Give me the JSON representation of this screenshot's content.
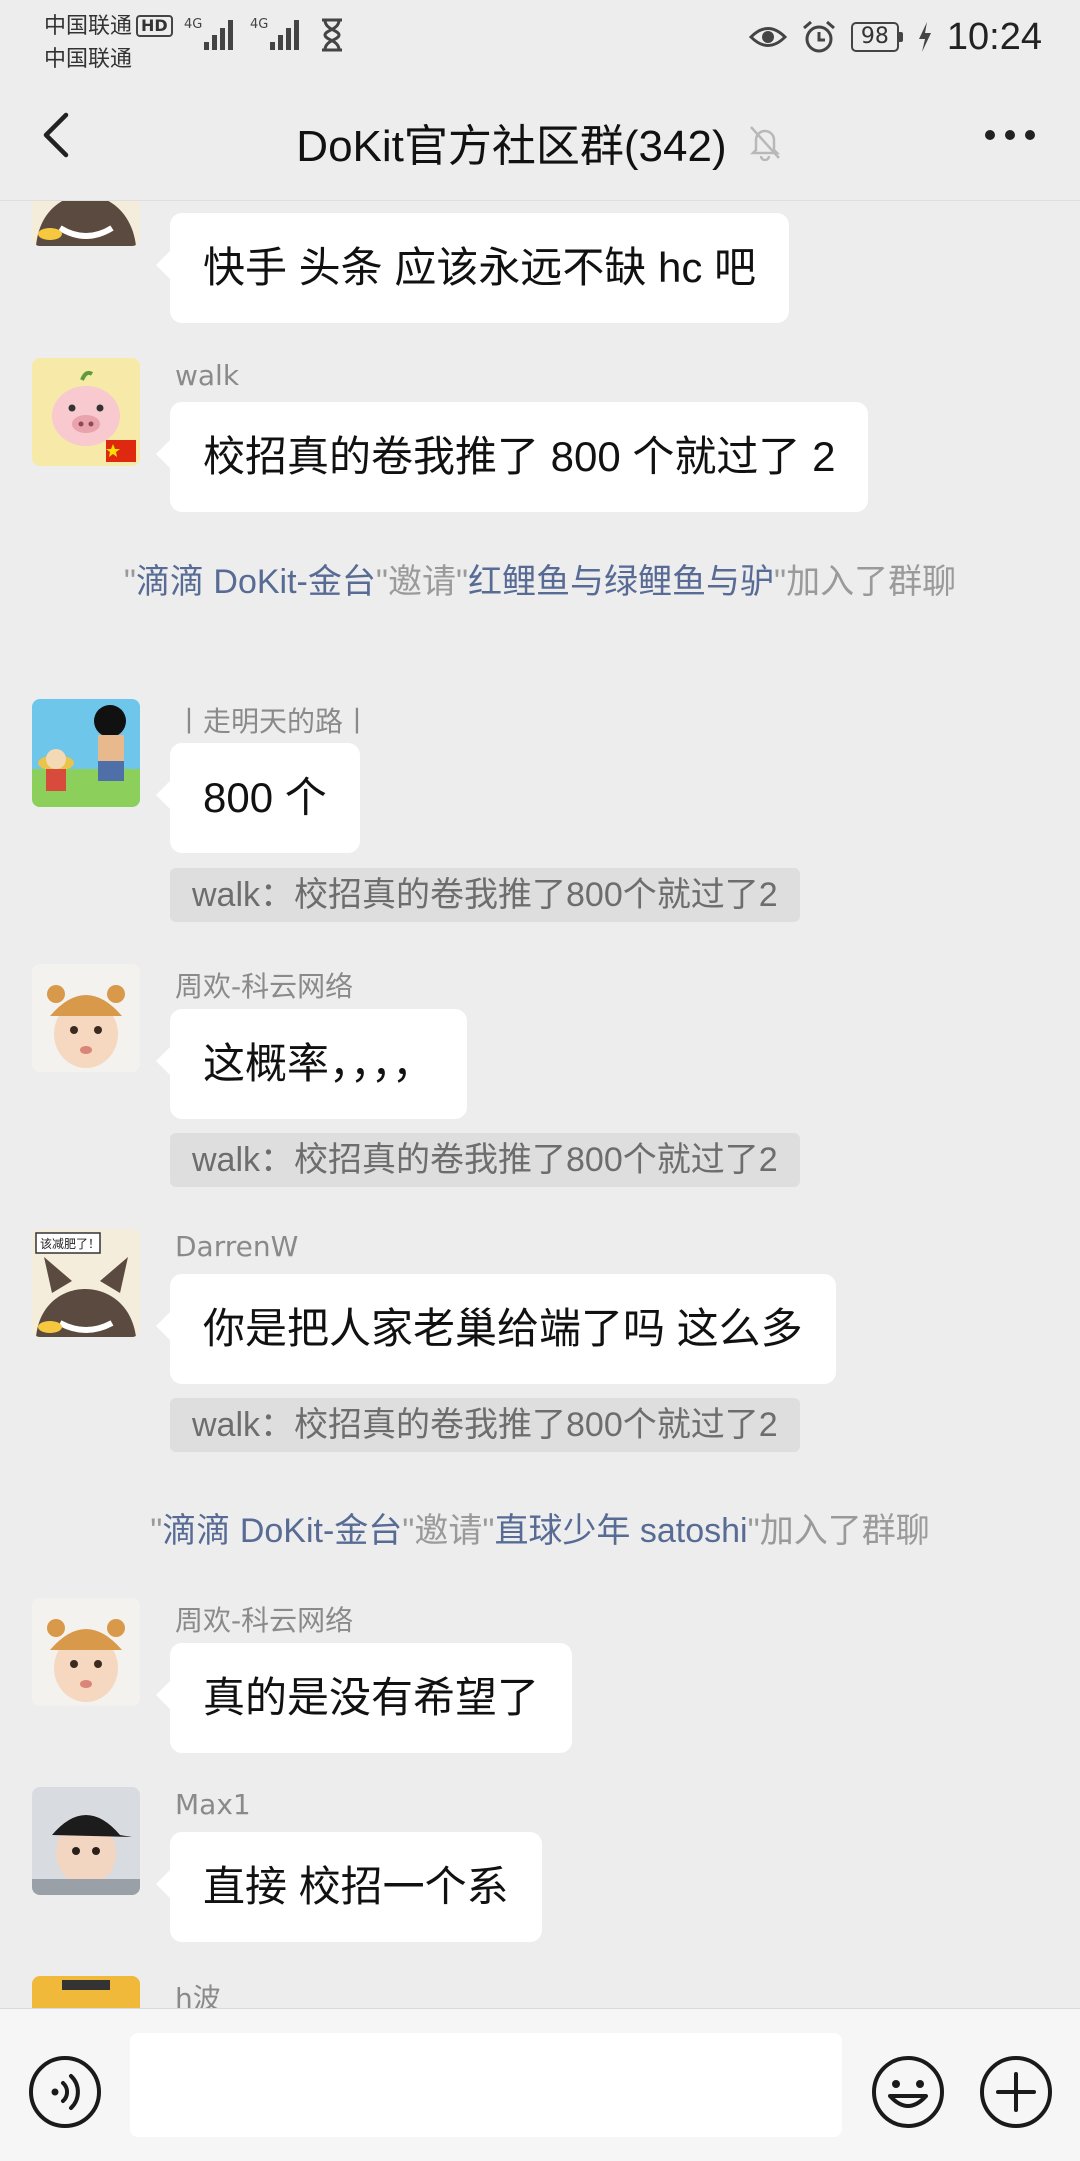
{
  "status": {
    "carrier1": "中国联通",
    "hd": "HD",
    "carrier2": "中国联通",
    "net1": "4G",
    "net2": "4G",
    "battery": "98",
    "time": "10:24"
  },
  "header": {
    "title": "DoKit官方社区群(342)"
  },
  "messages": {
    "m0": {
      "text": "快手 头条 应该永远不缺 hc 吧"
    },
    "m1": {
      "sender": "walk",
      "text": "校招真的卷我推了 800 个就过了 2"
    },
    "sys1": {
      "q1": "\"",
      "inviter": "滴滴 DoKit-金台",
      "mid": "\"邀请\"",
      "invitee": "红鲤鱼与绿鲤鱼与驴",
      "tail": "\"加入了群聊"
    },
    "m2": {
      "sender": "丨走明天的路丨",
      "text": "800 个",
      "quote": "walk：校招真的卷我推了800个就过了2"
    },
    "m3": {
      "sender": "周欢-科云网络",
      "text": "这概率，，，，",
      "quote": "walk：校招真的卷我推了800个就过了2"
    },
    "m4": {
      "sender": "DarrenW",
      "text": "你是把人家老巢给端了吗  这么多",
      "quote": "walk：校招真的卷我推了800个就过了2",
      "avatar_badge": "该减肥了！"
    },
    "sys2": {
      "q1": "\"",
      "inviter": "滴滴 DoKit-金台",
      "mid": "\"邀请\"",
      "invitee": "直球少年 satoshi",
      "tail": "\"加入了群聊"
    },
    "m5": {
      "sender": "周欢-科云网络",
      "text": "真的是没有希望了"
    },
    "m6": {
      "sender": "Max1",
      "text": "直接 校招一个系"
    },
    "m7": {
      "sender": "h波"
    }
  },
  "input": {
    "value": ""
  },
  "colors": {
    "background": "#ededed",
    "link": "#576b95",
    "bubble": "#ffffff"
  }
}
